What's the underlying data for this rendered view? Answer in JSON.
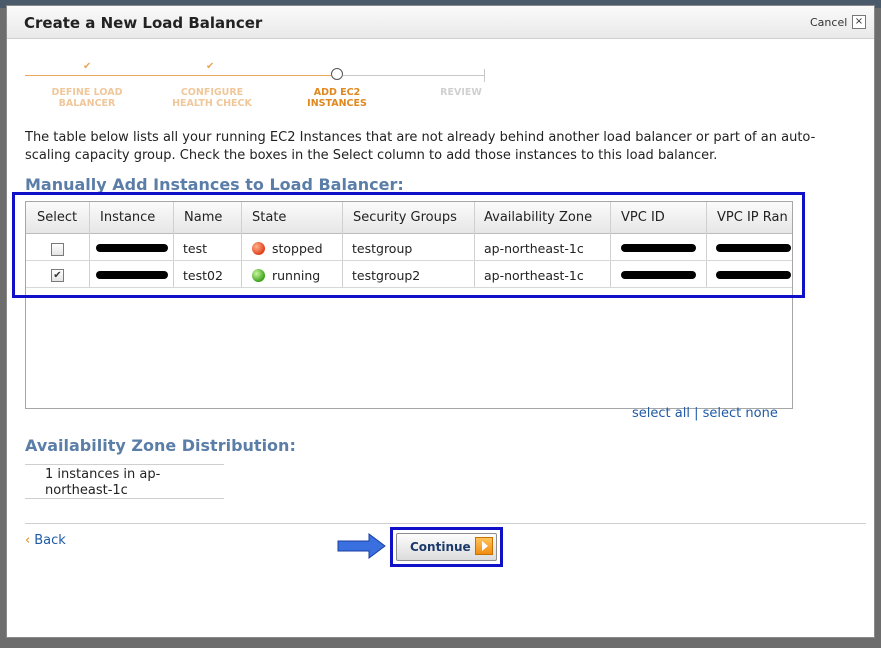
{
  "dialog": {
    "title": "Create a New Load Balancer",
    "cancel_label": "Cancel",
    "close_glyph": "×"
  },
  "wizard": {
    "steps": [
      {
        "line1": "DEFINE LOAD",
        "line2": "BALANCER",
        "status": "done"
      },
      {
        "line1": "CONFIGURE",
        "line2": "HEALTH CHECK",
        "status": "done"
      },
      {
        "line1": "ADD EC2",
        "line2": "INSTANCES",
        "status": "current"
      },
      {
        "line1": "REVIEW",
        "line2": "",
        "status": "future"
      }
    ],
    "check_glyph": "✔"
  },
  "intro_text": "The table below lists all your running EC2 Instances that are not already behind another load balancer or part of an auto-scaling capacity group. Check the boxes in the Select column to add those instances to this load balancer.",
  "manual_section": {
    "title": "Manually Add Instances to Load Balancer:"
  },
  "instances_table": {
    "headers": [
      "Select",
      "Instance",
      "Name",
      "State",
      "Security Groups",
      "Availability Zone",
      "VPC ID",
      "VPC IP Ran"
    ],
    "rows": [
      {
        "selected": false,
        "name": "test",
        "state": "stopped",
        "security_group": "testgroup",
        "zone": "ap-northeast-1c"
      },
      {
        "selected": true,
        "name": "test02",
        "state": "running",
        "security_group": "testgroup2",
        "zone": "ap-northeast-1c"
      }
    ],
    "checked_glyph": "✔"
  },
  "selection_links": {
    "all": "select all",
    "separator": "|",
    "none": "select none"
  },
  "az_section": {
    "title": "Availability Zone Distribution:",
    "text": "1 instances in ap-northeast-1c"
  },
  "footer": {
    "back_chevron": "‹",
    "back_label": "Back",
    "continue_label": "Continue"
  },
  "colors": {
    "accent_blue": "#5b7ea8",
    "link_blue": "#1f5aa6",
    "highlight_border": "#1010c8",
    "wizard_orange": "#e08820",
    "arrow_blue": "#3a6fe0"
  },
  "icons": {
    "state_stopped": "red-dot-icon",
    "state_running": "green-dot-icon",
    "continue": "orange-play-arrow-icon",
    "pointer": "blue-right-arrow-icon"
  }
}
